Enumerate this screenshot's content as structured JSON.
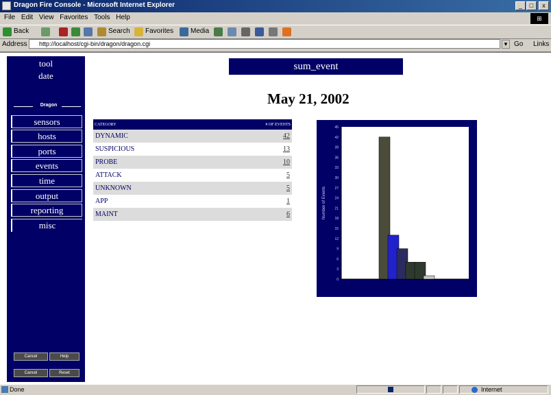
{
  "window": {
    "title": "Dragon Fire Console - Microsoft Internet Explorer",
    "buttons": {
      "minimize": "_",
      "maximize": "□",
      "close": "x"
    }
  },
  "menu": [
    "File",
    "Edit",
    "View",
    "Favorites",
    "Tools",
    "Help"
  ],
  "toolbar": {
    "back": "Back",
    "search": "Search",
    "favorites": "Favorites",
    "media": "Media"
  },
  "address": {
    "label": "Address",
    "url": "http://localhost/cgi-bin/dragon/dragon.cgi",
    "go": "Go",
    "links": "Links"
  },
  "sidebar": {
    "top_items": [
      "tool",
      "date"
    ],
    "separator": "Dragon",
    "items": [
      "sensors",
      "hosts",
      "ports",
      "events",
      "time",
      "output",
      "reporting",
      "misc"
    ],
    "bottom_buttons": [
      [
        "Cancel",
        "Help"
      ],
      [
        "Cancel",
        "Reset"
      ]
    ]
  },
  "main": {
    "header": "sum_event",
    "date": "May 21, 2002"
  },
  "table": {
    "headers": [
      "CATEGORY",
      "# OF EVENTS"
    ],
    "rows": [
      {
        "category": "DYNAMIC",
        "count": "42"
      },
      {
        "category": "SUSPICIOUS",
        "count": "13"
      },
      {
        "category": "PROBE",
        "count": "10"
      },
      {
        "category": "ATTACK",
        "count": "5"
      },
      {
        "category": "UNKNOWN",
        "count": "5"
      },
      {
        "category": "APP",
        "count": "1"
      },
      {
        "category": "MAINT",
        "count": "6"
      }
    ]
  },
  "chart_data": {
    "type": "bar",
    "ylabel": "Number of Events",
    "yticks": [
      "45",
      "42",
      "39",
      "36",
      "33",
      "30",
      "27",
      "24",
      "21",
      "18",
      "15",
      "12",
      "9",
      "6",
      "3",
      "0"
    ],
    "ylim": [
      0,
      45
    ],
    "values": [
      42,
      13,
      9,
      5,
      5,
      1
    ],
    "colors": [
      "#4b4b3a",
      "#2222cc",
      "#2b2b60",
      "#2f3a2f",
      "#2f3a2f",
      "#c8c8c8"
    ],
    "background": "#ffffff",
    "frame": "#000066"
  },
  "status": {
    "text": "Done",
    "zone": "Internet"
  }
}
